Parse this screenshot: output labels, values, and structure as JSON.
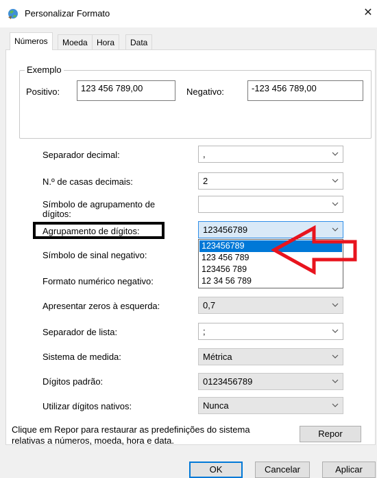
{
  "window": {
    "title": "Personalizar Formato",
    "close_glyph": "✕"
  },
  "tabs": [
    {
      "label": "Números",
      "active": true
    },
    {
      "label": "Moeda",
      "active": false
    },
    {
      "label": "Hora",
      "active": false
    },
    {
      "label": "Data",
      "active": false
    }
  ],
  "example": {
    "legend": "Exemplo",
    "positive_label": "Positivo:",
    "positive_value": "123 456 789,00",
    "negative_label": "Negativo:",
    "negative_value": "-123 456 789,00"
  },
  "settings": {
    "decimal_separator": {
      "label": "Separador decimal:",
      "value": ","
    },
    "decimal_places": {
      "label": "N.º de casas decimais:",
      "value": "2"
    },
    "grouping_symbol": {
      "label": "Símbolo de agrupamento de dígitos:",
      "value": ""
    },
    "digit_grouping": {
      "label": "Agrupamento de dígitos:",
      "value": "123456789"
    },
    "negative_sign": {
      "label": "Símbolo de sinal negativo:",
      "value": ""
    },
    "negative_format": {
      "label": "Formato numérico negativo:",
      "value": ""
    },
    "leading_zeros": {
      "label": "Apresentar zeros à esquerda:",
      "value": "0,7"
    },
    "list_separator": {
      "label": "Separador de lista:",
      "value": ";"
    },
    "measurement_system": {
      "label": "Sistema de medida:",
      "value": "Métrica"
    },
    "standard_digits": {
      "label": "Dígitos padrão:",
      "value": "0123456789"
    },
    "native_digits": {
      "label": "Utilizar dígitos nativos:",
      "value": "Nunca"
    }
  },
  "grouping_options": [
    "123456789",
    "123 456 789",
    "123456 789",
    "12 34 56 789"
  ],
  "footer": {
    "reset_text_line1": "Clique em Repor para restaurar as predefinições do sistema",
    "reset_text_line2": "relativas a números, moeda, hora e data.",
    "reset_button": "Repor",
    "ok_button": "OK",
    "cancel_button": "Cancelar",
    "apply_button": "Aplicar"
  },
  "colors": {
    "accent": "#0078d7",
    "annotation_arrow": "#e8141e"
  }
}
